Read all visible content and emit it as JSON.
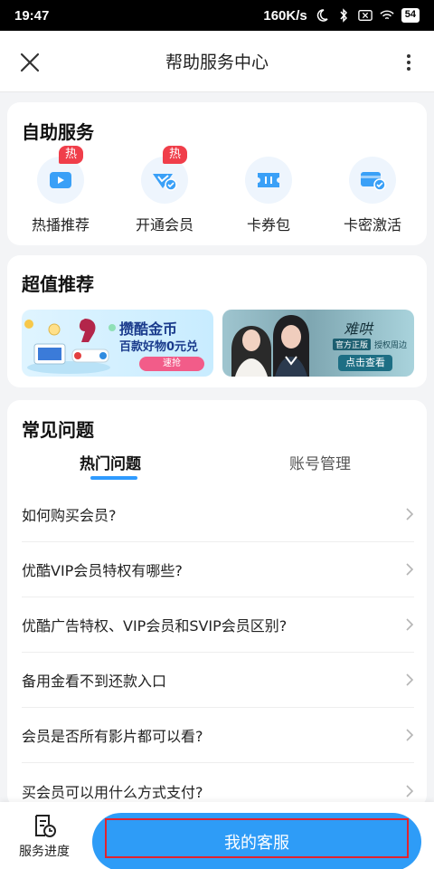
{
  "status_bar": {
    "time": "19:47",
    "speed": "160K/s",
    "battery": "54"
  },
  "header": {
    "title": "帮助服务中心",
    "close_icon": "close-icon",
    "more_icon": "more-vertical-icon"
  },
  "self_service": {
    "title": "自助服务",
    "items": [
      {
        "label": "热播推荐",
        "icon": "play-video-icon",
        "badge": "热"
      },
      {
        "label": "开通会员",
        "icon": "vip-check-icon",
        "badge": "热"
      },
      {
        "label": "卡券包",
        "icon": "ticket-icon",
        "badge": ""
      },
      {
        "label": "卡密激活",
        "icon": "card-activate-icon",
        "badge": ""
      }
    ]
  },
  "recommend": {
    "title": "超值推荐",
    "banner_left": {
      "title": "攒酷金币",
      "subtitle": "百款好物0元兑",
      "button": "速抢"
    },
    "banner_right": {
      "brand": "难哄",
      "tag1": "官方正版",
      "tag2": "授权周边",
      "button": "点击查看"
    }
  },
  "faq": {
    "title": "常见问题",
    "tabs": [
      {
        "label": "热门问题",
        "active": true
      },
      {
        "label": "账号管理",
        "active": false
      }
    ],
    "items": [
      {
        "text": "如何购买会员?"
      },
      {
        "text": "优酷VIP会员特权有哪些?"
      },
      {
        "text": "优酷广告特权、VIP会员和SVIP会员区别?"
      },
      {
        "text": "备用金看不到还款入口"
      },
      {
        "text": "会员是否所有影片都可以看?"
      },
      {
        "text": "买会员可以用什么方式支付?"
      }
    ]
  },
  "bottom_bar": {
    "progress_label": "服务进度",
    "service_label": "我的客服"
  },
  "colors": {
    "accent": "#2e9cf7",
    "hot_badge": "#f03e4a",
    "highlight_outline": "#e1232f"
  }
}
